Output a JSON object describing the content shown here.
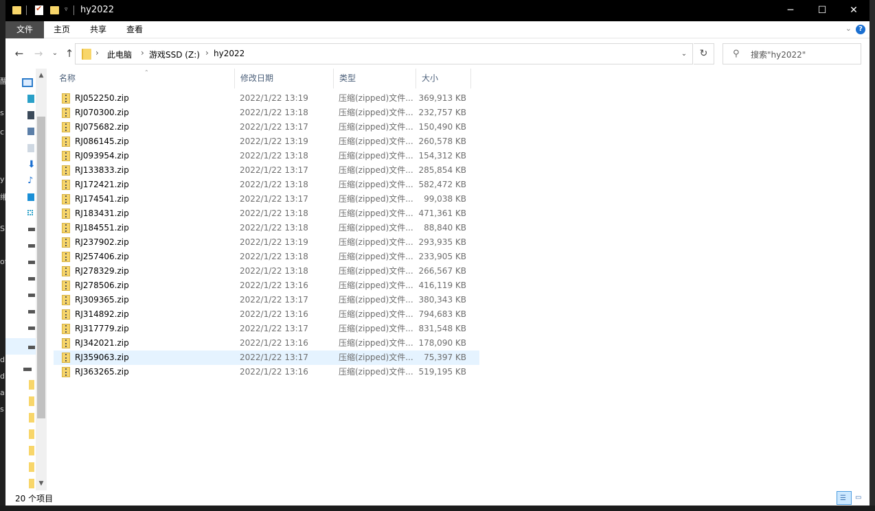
{
  "window": {
    "title": "hy2022"
  },
  "ribbon": {
    "tabs": [
      "文件",
      "主页",
      "共享",
      "查看"
    ]
  },
  "nav": {
    "breadcrumb": [
      "此电脑",
      "游戏SSD (Z:)",
      "hy2022"
    ],
    "search_placeholder": "搜索\"hy2022\""
  },
  "columns": {
    "name": "名称",
    "date": "修改日期",
    "type": "类型",
    "size": "大小"
  },
  "files": [
    {
      "name": "RJ052250.zip",
      "date": "2022/1/22 13:19",
      "type": "压缩(zipped)文件...",
      "size": "369,913 KB"
    },
    {
      "name": "RJ070300.zip",
      "date": "2022/1/22 13:18",
      "type": "压缩(zipped)文件...",
      "size": "232,757 KB"
    },
    {
      "name": "RJ075682.zip",
      "date": "2022/1/22 13:17",
      "type": "压缩(zipped)文件...",
      "size": "150,490 KB"
    },
    {
      "name": "RJ086145.zip",
      "date": "2022/1/22 13:19",
      "type": "压缩(zipped)文件...",
      "size": "260,578 KB"
    },
    {
      "name": "RJ093954.zip",
      "date": "2022/1/22 13:18",
      "type": "压缩(zipped)文件...",
      "size": "154,312 KB"
    },
    {
      "name": "RJ133833.zip",
      "date": "2022/1/22 13:17",
      "type": "压缩(zipped)文件...",
      "size": "285,854 KB"
    },
    {
      "name": "RJ172421.zip",
      "date": "2022/1/22 13:18",
      "type": "压缩(zipped)文件...",
      "size": "582,472 KB"
    },
    {
      "name": "RJ174541.zip",
      "date": "2022/1/22 13:17",
      "type": "压缩(zipped)文件...",
      "size": "99,038 KB"
    },
    {
      "name": "RJ183431.zip",
      "date": "2022/1/22 13:18",
      "type": "压缩(zipped)文件...",
      "size": "471,361 KB"
    },
    {
      "name": "RJ184551.zip",
      "date": "2022/1/22 13:18",
      "type": "压缩(zipped)文件...",
      "size": "88,840 KB"
    },
    {
      "name": "RJ237902.zip",
      "date": "2022/1/22 13:19",
      "type": "压缩(zipped)文件...",
      "size": "293,935 KB"
    },
    {
      "name": "RJ257406.zip",
      "date": "2022/1/22 13:18",
      "type": "压缩(zipped)文件...",
      "size": "233,905 KB"
    },
    {
      "name": "RJ278329.zip",
      "date": "2022/1/22 13:18",
      "type": "压缩(zipped)文件...",
      "size": "266,567 KB"
    },
    {
      "name": "RJ278506.zip",
      "date": "2022/1/22 13:16",
      "type": "压缩(zipped)文件...",
      "size": "416,119 KB"
    },
    {
      "name": "RJ309365.zip",
      "date": "2022/1/22 13:17",
      "type": "压缩(zipped)文件...",
      "size": "380,343 KB"
    },
    {
      "name": "RJ314892.zip",
      "date": "2022/1/22 13:16",
      "type": "压缩(zipped)文件...",
      "size": "794,683 KB"
    },
    {
      "name": "RJ317779.zip",
      "date": "2022/1/22 13:17",
      "type": "压缩(zipped)文件...",
      "size": "831,548 KB"
    },
    {
      "name": "RJ342021.zip",
      "date": "2022/1/22 13:16",
      "type": "压缩(zipped)文件...",
      "size": "178,090 KB"
    },
    {
      "name": "RJ359063.zip",
      "date": "2022/1/22 13:17",
      "type": "压缩(zipped)文件...",
      "size": "75,397 KB",
      "hovered": true
    },
    {
      "name": "RJ363265.zip",
      "date": "2022/1/22 13:16",
      "type": "压缩(zipped)文件...",
      "size": "519,195 KB"
    }
  ],
  "status": {
    "item_count": "20 个项目"
  },
  "colors": {
    "accent": "#0078d7",
    "hover_row": "#e5f3ff",
    "folder": "#f8d66a"
  }
}
